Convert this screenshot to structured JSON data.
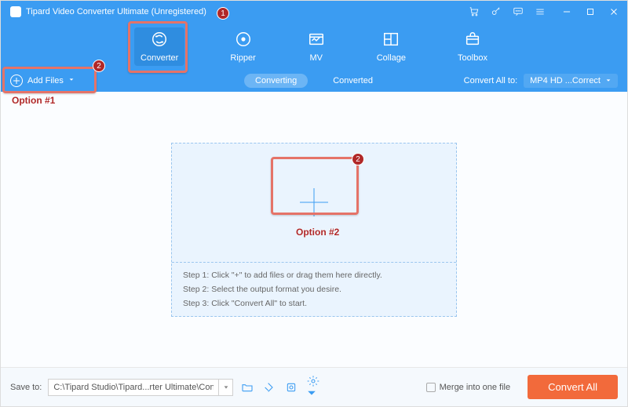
{
  "app": {
    "title": "Tipard Video Converter Ultimate (Unregistered)"
  },
  "nav": {
    "converter": "Converter",
    "ripper": "Ripper",
    "mv": "MV",
    "collage": "Collage",
    "toolbox": "Toolbox"
  },
  "subbar": {
    "add_files": "Add Files",
    "tab_converting": "Converting",
    "tab_converted": "Converted",
    "convert_all_to": "Convert All to:",
    "format": "MP4 HD ...Correct"
  },
  "drop": {
    "step1": "Step 1: Click \"+\" to add files or drag them here directly.",
    "step2": "Step 2: Select the output format you desire.",
    "step3": "Step 3: Click \"Convert All\" to start."
  },
  "footer": {
    "save_to": "Save to:",
    "path": "C:\\Tipard Studio\\Tipard...rter Ultimate\\Converted",
    "merge": "Merge into one file",
    "convert_all": "Convert All"
  },
  "anno": {
    "badge1": "1",
    "badge2": "2",
    "option1": "Option #1",
    "option2": "Option #2"
  }
}
